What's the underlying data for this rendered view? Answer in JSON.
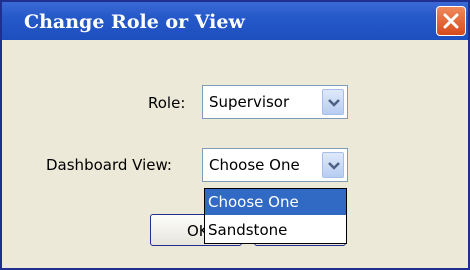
{
  "dialog": {
    "title": "Change Role or View",
    "close_icon": "close-x-icon"
  },
  "role": {
    "label": "Role:",
    "selected": "Supervisor"
  },
  "dashboard_view": {
    "label": "Dashboard View:",
    "selected": "Choose One",
    "options": [
      "Choose One",
      "Sandstone"
    ],
    "highlighted_option": "Choose One"
  },
  "buttons": {
    "ok_label": "OK",
    "cancel_label": ""
  },
  "colors": {
    "titlebar": "#2558c8",
    "dialog_bg": "#ece9d8",
    "selection": "#316ac5",
    "close_button": "#d64a1b"
  }
}
